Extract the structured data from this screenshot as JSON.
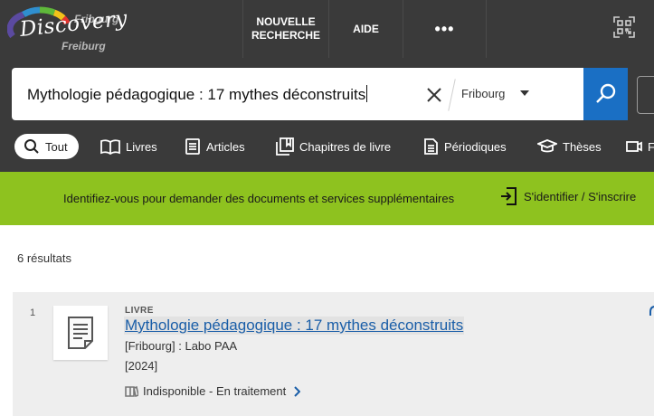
{
  "header": {
    "logo": {
      "top": "Fribourg",
      "main": "Discovery",
      "bottom": "Freiburg"
    },
    "nav": {
      "new_search": "NOUVELLE RECHERCHE",
      "help": "AIDE",
      "more": "•••"
    },
    "icons": {
      "qr": "qr-code-icon",
      "more": "ellipsis-icon"
    }
  },
  "search": {
    "query": "Mythologie pédagogique : 17 mythes déconstruits",
    "scope": "Fribourg",
    "icons": {
      "clear": "close-icon",
      "dropdown": "chevron-down-icon",
      "submit": "search-icon"
    }
  },
  "tabs": [
    {
      "label": "Tout",
      "icon": "search-icon",
      "active": true
    },
    {
      "label": "Livres",
      "icon": "book-icon",
      "active": false
    },
    {
      "label": "Articles",
      "icon": "article-icon",
      "active": false
    },
    {
      "label": "Chapitres de livre",
      "icon": "book-chapter-icon",
      "active": false
    },
    {
      "label": "Périodiques",
      "icon": "periodical-icon",
      "active": false
    },
    {
      "label": "Thèses",
      "icon": "graduation-cap-icon",
      "active": false
    },
    {
      "label": "F",
      "icon": "film-icon",
      "active": false
    }
  ],
  "banner": {
    "message": "Identifiez-vous pour demander des documents et services supplémentaires",
    "signin": "S'identifier / S'inscrire",
    "color": "#8ec21f"
  },
  "results": {
    "count_label": "6 résultats",
    "items": [
      {
        "number": "1",
        "type": "LIVRE",
        "title": "Mythologie pédagogique : 17 mythes déconstruits",
        "publisher": "[Fribourg] : Labo PAA",
        "year": "[2024]",
        "availability": "Indisponible - En traitement"
      }
    ]
  },
  "colors": {
    "header_bg": "#3a3a3a",
    "accent_blue": "#1a6fc4",
    "link": "#1a5ea8"
  }
}
